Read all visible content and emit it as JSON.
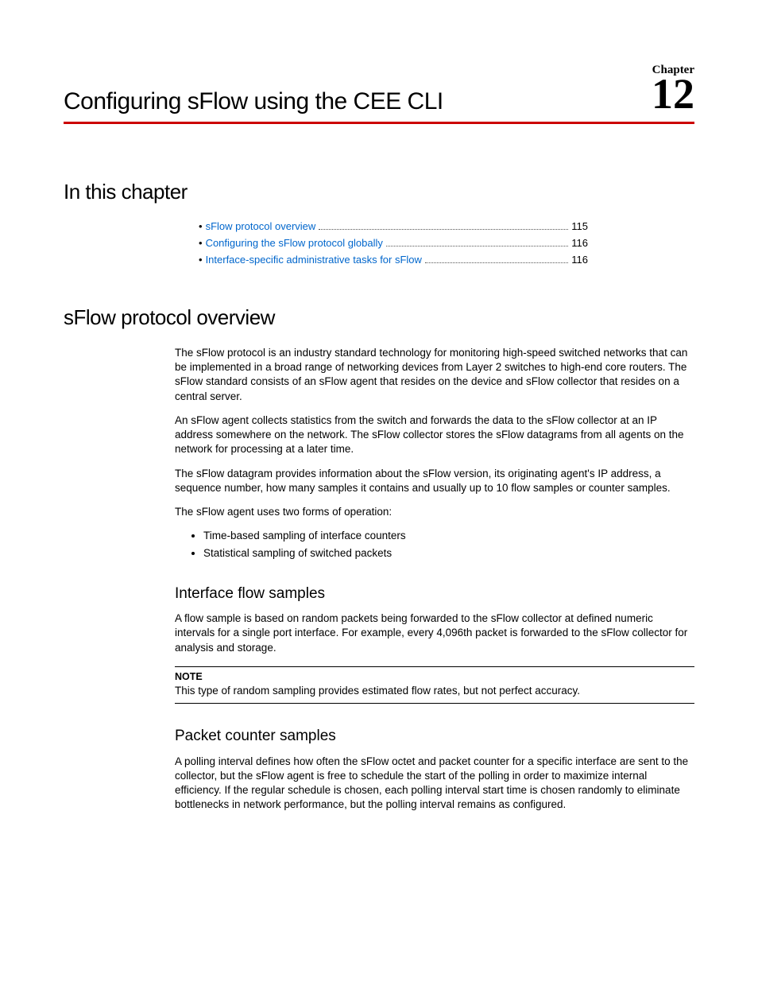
{
  "header": {
    "chapter_label": "Chapter",
    "chapter_number": "12",
    "title": "Configuring sFlow using the CEE CLI"
  },
  "toc": {
    "heading": "In this chapter",
    "items": [
      {
        "label": "sFlow protocol overview",
        "page": "115"
      },
      {
        "label": "Configuring the sFlow protocol globally",
        "page": "116"
      },
      {
        "label": "Interface-specific administrative tasks for sFlow",
        "page": "116"
      }
    ]
  },
  "overview": {
    "heading": "sFlow protocol overview",
    "p1": "The sFlow protocol is an industry standard technology for monitoring high-speed switched networks that can be implemented in a broad range of networking devices from Layer 2 switches to high-end core routers. The sFlow standard consists of an sFlow agent that resides on the device and sFlow collector that resides on a central server.",
    "p2": "An sFlow agent collects statistics from the switch and forwards the data to the sFlow collector at an IP address somewhere on the network. The sFlow collector stores the sFlow datagrams from all agents on the network for processing at a later time.",
    "p3": "The sFlow datagram provides information about the sFlow version, its originating agent's IP address, a sequence number, how many samples it contains and usually up to 10 flow samples or counter samples.",
    "p4": "The sFlow agent uses two forms of operation:",
    "bullets": [
      "Time-based sampling of interface counters",
      "Statistical sampling of switched packets"
    ]
  },
  "interface_flow": {
    "heading": "Interface flow samples",
    "p1": "A flow sample is based on random packets being forwarded to the sFlow collector at defined numeric intervals for a single port interface. For example, every 4,096th packet is forwarded to the sFlow collector for analysis and storage.",
    "note_label": "NOTE",
    "note_text": "This type of random sampling provides estimated flow rates, but not perfect accuracy."
  },
  "packet_counter": {
    "heading": "Packet counter samples",
    "p1": "A polling interval defines how often the sFlow octet and packet counter for a specific interface are sent to the collector, but the sFlow agent is free to schedule the start of the polling in order to maximize internal efficiency. If the regular schedule is chosen, each polling interval start time is chosen randomly to eliminate bottlenecks in network performance, but the polling interval remains as configured."
  }
}
